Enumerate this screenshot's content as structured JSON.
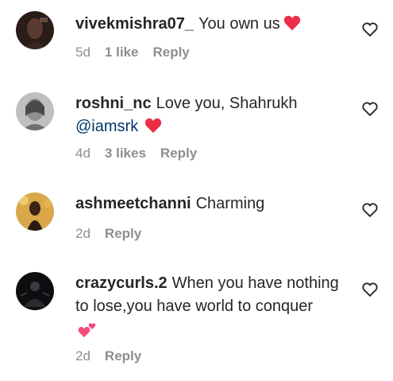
{
  "comments": [
    {
      "username": "vivekmishra07_",
      "text": "You own us",
      "time": "5d",
      "likes": "1 like",
      "reply": "Reply",
      "emoji": "red-heart-icon"
    },
    {
      "username": "roshni_nc",
      "text": "Love you, Shahrukh",
      "mention": "@iamsrk",
      "time": "4d",
      "likes": "3 likes",
      "reply": "Reply",
      "emoji": "red-heart-icon"
    },
    {
      "username": "ashmeetchanni",
      "text": "Charming",
      "time": "2d",
      "reply": "Reply"
    },
    {
      "username": "crazycurls.2",
      "text": "When you have nothing to lose,you have world to conquer",
      "time": "2d",
      "reply": "Reply",
      "emoji": "two-hearts-icon"
    }
  ],
  "colors": {
    "text": "#262626",
    "meta": "#8e8e8e",
    "mention": "#00376b",
    "heart": "#ed2c45",
    "pink_heart": "#f54c7c"
  }
}
